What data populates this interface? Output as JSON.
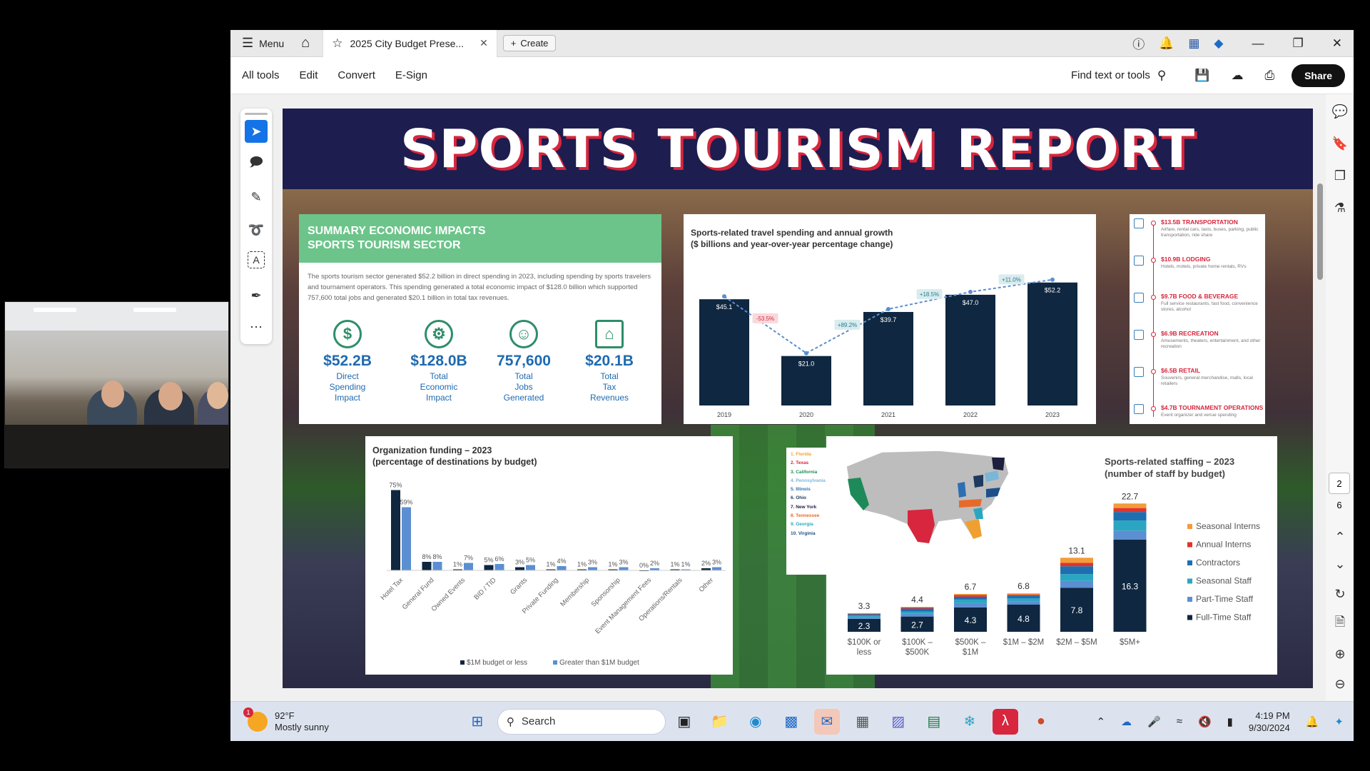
{
  "app": {
    "menu_label": "Menu",
    "tab_title": "2025 City Budget Prese...",
    "create_label": "Create",
    "toolbar_items": [
      "All tools",
      "Edit",
      "Convert",
      "E-Sign"
    ],
    "find_label": "Find text or tools",
    "share_label": "Share"
  },
  "page_indicators": {
    "current": "2",
    "total": "6"
  },
  "document": {
    "title": "SPORTS TOURISM REPORT",
    "summary": {
      "heading_line1": "SUMMARY ECONOMIC IMPACTS",
      "heading_line2": "SPORTS TOURISM SECTOR",
      "body": "The sports tourism sector generated $52.2 billion in direct spending in 2023, including spending by sports travelers and tournament operators. This spending generated a total economic impact of $128.0 billion which supported 757,600 total jobs and generated $20.1 billion in total tax revenues.",
      "metrics": [
        {
          "value": "$52.2B",
          "label": "Direct\nSpending\nImpact",
          "icon": "globe-dollar-icon"
        },
        {
          "value": "$128.0B",
          "label": "Total\nEconomic\nImpact",
          "icon": "gears-dollar-icon"
        },
        {
          "value": "757,600",
          "label": "Total\nJobs\nGenerated",
          "icon": "people-icon"
        },
        {
          "value": "$20.1B",
          "label": "Total\nTax\nRevenues",
          "icon": "bank-icon"
        }
      ]
    },
    "side_list": [
      {
        "title": "$13.5B TRANSPORTATION",
        "desc": "Airfare, rental cars, taxis, buses, parking, public transportation, ride share"
      },
      {
        "title": "$10.9B LODGING",
        "desc": "Hotels, motels, private home rentals, RVs"
      },
      {
        "title": "$9.7B FOOD & BEVERAGE",
        "desc": "Full service restaurants, fast food, convenience stores, alcohol"
      },
      {
        "title": "$6.9B RECREATION",
        "desc": "Amusements, theaters, entertainment, and other recreation"
      },
      {
        "title": "$6.5B RETAIL",
        "desc": "Souvenirs, general merchandise, malls, local retailers"
      },
      {
        "title": "$4.7B TOURNAMENT OPERATIONS",
        "desc": "Event organizer and venue spending"
      }
    ],
    "top_states": [
      "1. Florida",
      "2. Texas",
      "3. California",
      "4. Pennsylvania",
      "5. Illinois",
      "6. Ohio",
      "7. New York",
      "8. Tennessee",
      "9. Georgia",
      "10. Virginia"
    ],
    "state_colors": [
      "#f0a030",
      "#d7263d",
      "#1e8a5a",
      "#7ab6d8",
      "#2d6fb2",
      "#1e3a5f",
      "#1e1e3f",
      "#e86a2a",
      "#2ba6c2",
      "#1e4f8a"
    ]
  },
  "chart_data": [
    {
      "type": "bar",
      "title": "Sports-related travel spending and annual growth",
      "subtitle": "($ billions and year-over-year percentage change)",
      "categories": [
        "2019",
        "2020",
        "2021",
        "2022",
        "2023"
      ],
      "values": [
        45.1,
        21.0,
        39.7,
        47.0,
        52.2
      ],
      "value_labels": [
        "$45.1",
        "$21.0",
        "$39.7",
        "$47.0",
        "$52.2"
      ],
      "growth_labels": [
        "-53.5%",
        "+89.2%",
        "+18.5%",
        "+11.0%"
      ],
      "ylim": [
        0,
        60
      ],
      "color": "#0f2740"
    },
    {
      "type": "bar",
      "title": "Organization funding – 2023",
      "subtitle": "(percentage of destinations by budget)",
      "categories": [
        "Hotel Tax",
        "General Fund",
        "Owned Events",
        "BID / TID",
        "Grants",
        "Private Funding",
        "Membership",
        "Sponsorship",
        "Event Management Fees",
        "Operations/Rentals",
        "Other"
      ],
      "series": [
        {
          "name": "$1M budget or less",
          "values": [
            75,
            8,
            1,
            5,
            3,
            1,
            1,
            1,
            0,
            1,
            2
          ],
          "labels": [
            "75%",
            "8%",
            "1%",
            "5%",
            "3%",
            "1%",
            "1%",
            "1%",
            "0%",
            "1%",
            "2%"
          ],
          "color": "#0f2740"
        },
        {
          "name": "Greater than $1M budget",
          "values": [
            59,
            8,
            7,
            6,
            5,
            4,
            3,
            3,
            2,
            1,
            3
          ],
          "labels": [
            "59%",
            "8%",
            "7%",
            "6%",
            "5%",
            "4%",
            "3%",
            "3%",
            "2%",
            "1%",
            "3%"
          ],
          "color": "#5b8fd1"
        }
      ],
      "ylim": [
        0,
        80
      ]
    },
    {
      "type": "bar",
      "stacked": true,
      "title": "Sports-related staffing – 2023",
      "subtitle": "(number of staff by budget)",
      "categories": [
        "$100K or less",
        "$100K – $500K",
        "$500K – $1M",
        "$1M – $2M",
        "$2M – $5M",
        "$5M+"
      ],
      "totals": [
        "3.3",
        "4.4",
        "6.7",
        "6.8",
        "13.1",
        "22.7"
      ],
      "fulltime_labels": [
        "2.3",
        "2.7",
        "4.3",
        "4.8",
        "7.8",
        "16.3"
      ],
      "series": [
        {
          "name": "Full-Time Staff",
          "values": [
            2.3,
            2.7,
            4.3,
            4.8,
            7.8,
            16.3
          ],
          "color": "#0f2740"
        },
        {
          "name": "Part-Time Staff",
          "values": [
            0.3,
            0.5,
            0.8,
            0.6,
            1.2,
            1.6
          ],
          "color": "#5b8fd1"
        },
        {
          "name": "Seasonal Staff",
          "values": [
            0.3,
            0.4,
            0.6,
            0.5,
            1.2,
            1.8
          ],
          "color": "#2ba6c2"
        },
        {
          "name": "Contractors",
          "values": [
            0.2,
            0.5,
            0.5,
            0.5,
            1.4,
            1.5
          ],
          "color": "#1e6fb0"
        },
        {
          "name": "Annual Interns",
          "values": [
            0.1,
            0.2,
            0.3,
            0.2,
            0.6,
            0.7
          ],
          "color": "#e0342e"
        },
        {
          "name": "Seasonal Interns",
          "values": [
            0.1,
            0.1,
            0.2,
            0.2,
            0.9,
            0.8
          ],
          "color": "#f39c3a"
        }
      ],
      "ylim": [
        0,
        24
      ]
    }
  ],
  "taskbar": {
    "weather_temp": "92°F",
    "weather_desc": "Mostly sunny",
    "weather_badge": "1",
    "search_label": "Search",
    "time": "4:19 PM",
    "date": "9/30/2024"
  }
}
